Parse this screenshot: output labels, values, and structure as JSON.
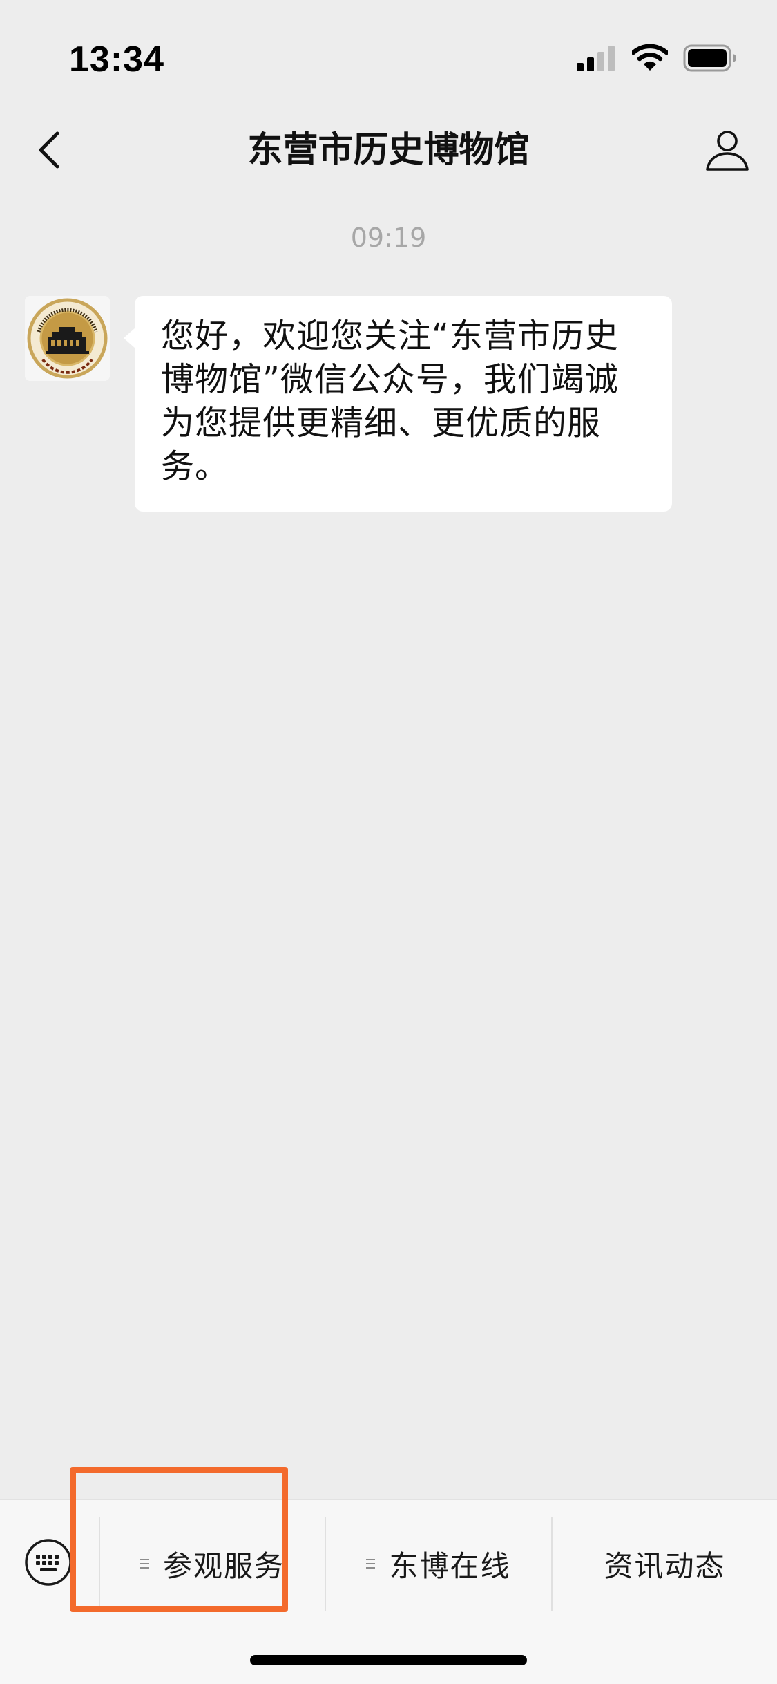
{
  "status_bar": {
    "time": "13:34",
    "icons": [
      "cellular-signal-icon",
      "wifi-icon",
      "battery-icon"
    ]
  },
  "nav": {
    "title": "东营市历史博物馆",
    "back_icon": "chevron-left-icon",
    "profile_icon": "person-icon"
  },
  "chat": {
    "timestamp": "09:19",
    "messages": [
      {
        "sender_avatar": "history-museum-logo",
        "avatar_logo_text": "THE HISTORY MUSEUM OF DONGYING CITY",
        "text": "您好，欢迎您关注“东营市历史博物馆”微信公众号，我们竭诚为您提供更精细、更优质的服务。"
      }
    ]
  },
  "bottom_menu": {
    "keyboard_icon": "keyboard-icon",
    "items": [
      {
        "label": "参观服务",
        "has_submenu": true,
        "highlighted": true
      },
      {
        "label": "东博在线",
        "has_submenu": true,
        "highlighted": false
      },
      {
        "label": "资讯动态",
        "has_submenu": false,
        "highlighted": false
      }
    ]
  },
  "colors": {
    "background": "#ededed",
    "bubble": "#ffffff",
    "highlight": "#f36a2c",
    "timestamp": "#a7a7a7"
  }
}
